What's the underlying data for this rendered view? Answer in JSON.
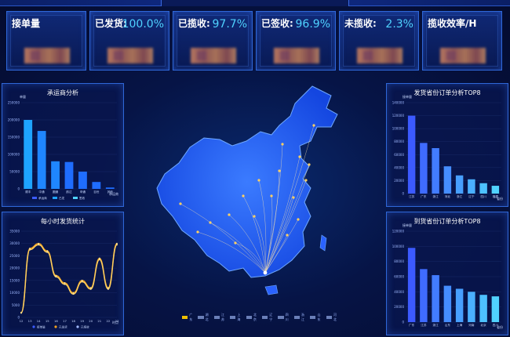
{
  "kpis": [
    {
      "label": "接单量",
      "value": ""
    },
    {
      "label": "已发货:",
      "value": "100.0%"
    },
    {
      "label": "已揽收:",
      "value": "97.7%"
    },
    {
      "label": "已签收:",
      "value": "96.9%"
    },
    {
      "label": "未揽收:",
      "value": "2.3%"
    },
    {
      "label": "揽收效率/H",
      "value": ""
    }
  ],
  "colors": {
    "accent": "#4fd2ff",
    "bar_cyan": "#1ea4ff",
    "bar_blue": "#3b5cff",
    "line_orange": "#f0a020",
    "map_fill": "#1e56ff"
  },
  "chart_data": [
    {
      "type": "bar",
      "title": "承运商分析",
      "ylabel": "单量",
      "xlabel": "承运商",
      "categories": [
        "顺丰",
        "中通",
        "圆通",
        "韵达",
        "申通",
        "百世",
        "其他"
      ],
      "y_ticks": [
        "0",
        "50000",
        "100000",
        "150000",
        "200000",
        "250000"
      ],
      "ylim": [
        0,
        250000
      ],
      "values": [
        200000,
        168000,
        80000,
        78000,
        50000,
        20000,
        4000
      ],
      "legend": [
        "承运商",
        "已发",
        "签收"
      ]
    },
    {
      "type": "line",
      "title": "每小时发货统计",
      "xlabel": "时点",
      "x": [
        "12",
        "13",
        "14",
        "15",
        "16",
        "17",
        "18",
        "19",
        "20",
        "21",
        "22",
        "23"
      ],
      "y_ticks": [
        "0",
        "5000",
        "10000",
        "15000",
        "20000",
        "25000",
        "30000",
        "35000"
      ],
      "ylim": [
        0,
        35000
      ],
      "series": [
        {
          "name": "接单量",
          "values": [
            2000,
            28000,
            30000,
            27000,
            17000,
            14000,
            10000,
            15000,
            12000,
            24000,
            12000,
            30000
          ]
        },
        {
          "name": "已发货",
          "values": [
            1800,
            27500,
            29500,
            26500,
            16500,
            13500,
            9500,
            14500,
            11500,
            23500,
            11500,
            29500
          ]
        }
      ],
      "legend": [
        "接单量",
        "已发货",
        "已揽收"
      ]
    },
    {
      "type": "bar",
      "title": "发货省份订单分析TOP8",
      "ylabel": "接单量",
      "xlabel": "省份",
      "categories": [
        "江苏",
        "广东",
        "浙江",
        "河北",
        "浙江",
        "辽宁",
        "四川",
        "福建"
      ],
      "y_ticks": [
        "0",
        "20000",
        "40000",
        "60000",
        "80000",
        "100000",
        "120000",
        "140000"
      ],
      "ylim": [
        0,
        140000
      ],
      "values": [
        120000,
        78000,
        70000,
        42000,
        28000,
        22000,
        16000,
        12000
      ]
    },
    {
      "type": "bar",
      "title": "到货省份订单分析TOP8",
      "ylabel": "接单量",
      "xlabel": "省份",
      "categories": [
        "广东",
        "江苏",
        "浙江",
        "山东",
        "上海",
        "河南",
        "北京",
        "四川"
      ],
      "y_ticks": [
        "0",
        "20000",
        "40000",
        "60000",
        "80000",
        "100000",
        "120000"
      ],
      "ylim": [
        0,
        120000
      ],
      "values": [
        98000,
        70000,
        62000,
        48000,
        44000,
        40000,
        36000,
        34000
      ]
    }
  ],
  "map": {
    "legend": [
      "广东",
      "湖北",
      "江苏",
      "上海",
      "北京",
      "辽宁",
      "四川",
      "浙江",
      "山东",
      "河北"
    ]
  }
}
